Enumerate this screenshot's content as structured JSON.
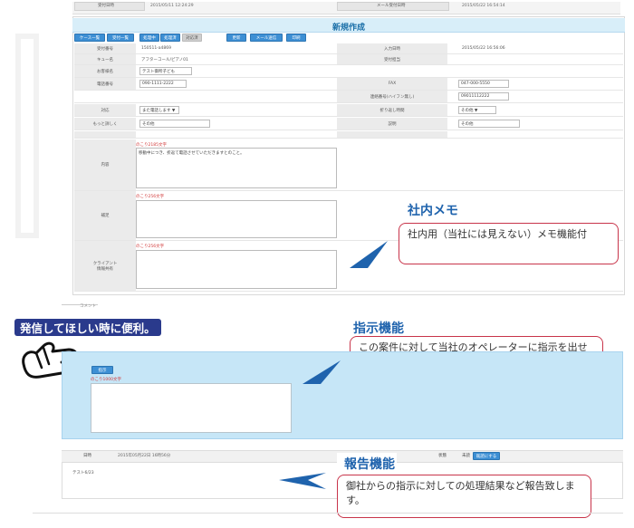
{
  "top": {
    "received_datetime_label": "受付日時",
    "received_datetime_value": "2015/05/11 12:24:29",
    "mail_received_label": "メール受付日時",
    "mail_received_value": "2015/05/22 16:54:14"
  },
  "form": {
    "title": "新規作成",
    "toolbar_left": [
      "ケース一覧",
      "受付一覧",
      "処理中",
      "処理済",
      "対応済"
    ],
    "toolbar_right": [
      "更新",
      "メール送信",
      "印刷"
    ],
    "rows": {
      "accept_no_label": "受付番号",
      "accept_no_value": "150511-a4869",
      "input_date_label": "入力日時",
      "input_date_value": "2015/05/22 16:56:06",
      "queue_label": "キュー名",
      "queue_value": "アフターコール/ピアノ01",
      "accept_operator_label": "受付担当",
      "customer_label": "お客様名",
      "customer_value": "テスト御所子ども",
      "phone_label": "電話番号",
      "phone_value": "090-1111-2222",
      "fax_label": "FAX",
      "fax_value": "047-000-5550",
      "alt_phone_label": "連絡番号(ハイフン無し)",
      "alt_phone_value": "09011112222",
      "response_label": "対応",
      "response_value": "また電話します ▼",
      "callback_label": "折り返し時間",
      "callback_value": "その他 ▼",
      "other_label": "もっと詳しく",
      "other_value": "その他",
      "memo_label": "説明",
      "memo_value": "その他"
    },
    "content_label": "内容",
    "content_count": "のこり2185文字",
    "content_text": "移動中につき、折返て電話させていただきますとのこと。",
    "note_label": "補足",
    "note_count": "のこり256文字",
    "client_label": "クライアント\n情報共有",
    "client_count": "のこり256文字"
  },
  "callouts": {
    "memo_heading": "社内メモ",
    "memo_text": "社内用（当社には見えない）メモ機能付",
    "instr_heading": "指示機能",
    "instr_text": "この案件に対して当社のオペレーターに指示を出せます。",
    "report_heading": "報告機能",
    "report_text": "御社からの指示に対しての処理結果など報告致します。",
    "badge": "発信してほしい時に便利。"
  },
  "comment": {
    "section_label": "コメント",
    "instr_section_label": "コメント",
    "instr_button": "指示",
    "instr_count": "のこり1000文字",
    "report_datetime_label": "日時",
    "report_datetime_value": "2015年05月22日 16時56分",
    "report_status_label": "状態",
    "report_user_label": "未読",
    "report_button": "既読にする",
    "report_body": "テスト6/23"
  },
  "colors": {
    "title_blue": "#1a6fa8",
    "panel_blue": "#c6e6f7",
    "callout_border": "#c8344a",
    "heading_blue": "#1f63ad",
    "arrow_blue": "#1f63ad",
    "badge_navy": "#2a3a8c",
    "count_red": "#d23a3a"
  }
}
